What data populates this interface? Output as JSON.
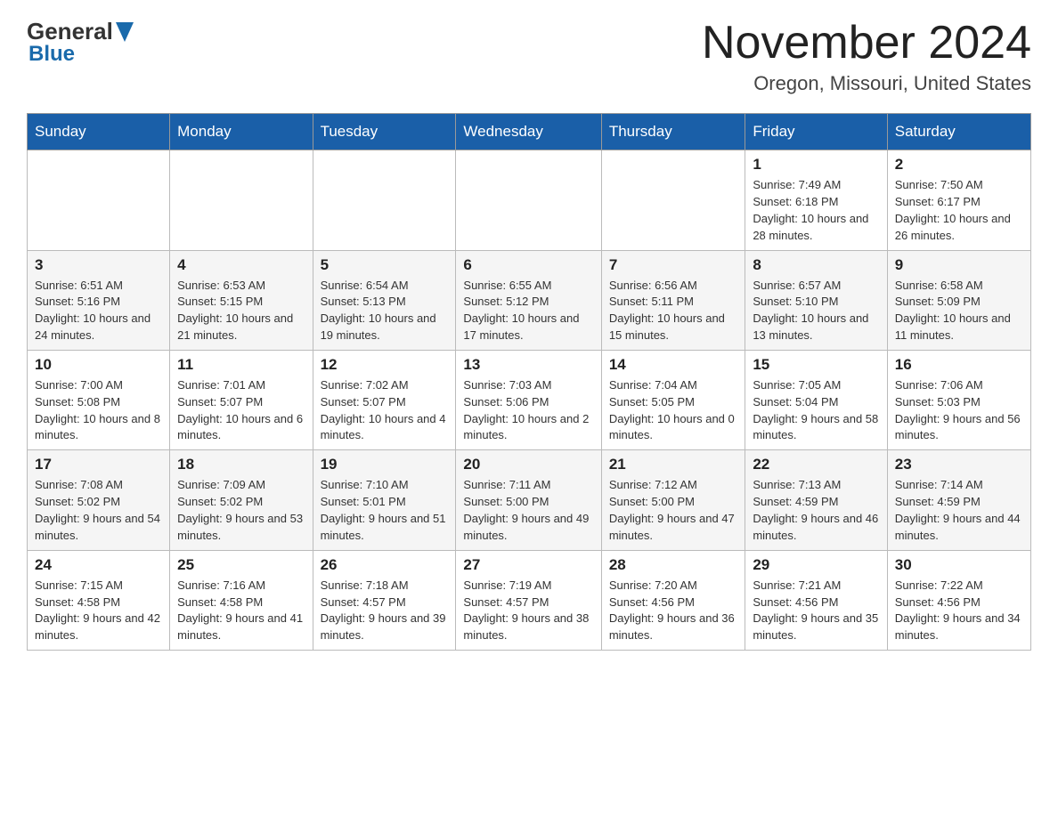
{
  "header": {
    "logo_general": "General",
    "logo_blue": "Blue",
    "month_title": "November 2024",
    "location": "Oregon, Missouri, United States"
  },
  "calendar": {
    "days_of_week": [
      "Sunday",
      "Monday",
      "Tuesday",
      "Wednesday",
      "Thursday",
      "Friday",
      "Saturday"
    ],
    "weeks": [
      {
        "days": [
          {
            "num": "",
            "info": ""
          },
          {
            "num": "",
            "info": ""
          },
          {
            "num": "",
            "info": ""
          },
          {
            "num": "",
            "info": ""
          },
          {
            "num": "",
            "info": ""
          },
          {
            "num": "1",
            "info": "Sunrise: 7:49 AM\nSunset: 6:18 PM\nDaylight: 10 hours and 28 minutes."
          },
          {
            "num": "2",
            "info": "Sunrise: 7:50 AM\nSunset: 6:17 PM\nDaylight: 10 hours and 26 minutes."
          }
        ]
      },
      {
        "days": [
          {
            "num": "3",
            "info": "Sunrise: 6:51 AM\nSunset: 5:16 PM\nDaylight: 10 hours and 24 minutes."
          },
          {
            "num": "4",
            "info": "Sunrise: 6:53 AM\nSunset: 5:15 PM\nDaylight: 10 hours and 21 minutes."
          },
          {
            "num": "5",
            "info": "Sunrise: 6:54 AM\nSunset: 5:13 PM\nDaylight: 10 hours and 19 minutes."
          },
          {
            "num": "6",
            "info": "Sunrise: 6:55 AM\nSunset: 5:12 PM\nDaylight: 10 hours and 17 minutes."
          },
          {
            "num": "7",
            "info": "Sunrise: 6:56 AM\nSunset: 5:11 PM\nDaylight: 10 hours and 15 minutes."
          },
          {
            "num": "8",
            "info": "Sunrise: 6:57 AM\nSunset: 5:10 PM\nDaylight: 10 hours and 13 minutes."
          },
          {
            "num": "9",
            "info": "Sunrise: 6:58 AM\nSunset: 5:09 PM\nDaylight: 10 hours and 11 minutes."
          }
        ]
      },
      {
        "days": [
          {
            "num": "10",
            "info": "Sunrise: 7:00 AM\nSunset: 5:08 PM\nDaylight: 10 hours and 8 minutes."
          },
          {
            "num": "11",
            "info": "Sunrise: 7:01 AM\nSunset: 5:07 PM\nDaylight: 10 hours and 6 minutes."
          },
          {
            "num": "12",
            "info": "Sunrise: 7:02 AM\nSunset: 5:07 PM\nDaylight: 10 hours and 4 minutes."
          },
          {
            "num": "13",
            "info": "Sunrise: 7:03 AM\nSunset: 5:06 PM\nDaylight: 10 hours and 2 minutes."
          },
          {
            "num": "14",
            "info": "Sunrise: 7:04 AM\nSunset: 5:05 PM\nDaylight: 10 hours and 0 minutes."
          },
          {
            "num": "15",
            "info": "Sunrise: 7:05 AM\nSunset: 5:04 PM\nDaylight: 9 hours and 58 minutes."
          },
          {
            "num": "16",
            "info": "Sunrise: 7:06 AM\nSunset: 5:03 PM\nDaylight: 9 hours and 56 minutes."
          }
        ]
      },
      {
        "days": [
          {
            "num": "17",
            "info": "Sunrise: 7:08 AM\nSunset: 5:02 PM\nDaylight: 9 hours and 54 minutes."
          },
          {
            "num": "18",
            "info": "Sunrise: 7:09 AM\nSunset: 5:02 PM\nDaylight: 9 hours and 53 minutes."
          },
          {
            "num": "19",
            "info": "Sunrise: 7:10 AM\nSunset: 5:01 PM\nDaylight: 9 hours and 51 minutes."
          },
          {
            "num": "20",
            "info": "Sunrise: 7:11 AM\nSunset: 5:00 PM\nDaylight: 9 hours and 49 minutes."
          },
          {
            "num": "21",
            "info": "Sunrise: 7:12 AM\nSunset: 5:00 PM\nDaylight: 9 hours and 47 minutes."
          },
          {
            "num": "22",
            "info": "Sunrise: 7:13 AM\nSunset: 4:59 PM\nDaylight: 9 hours and 46 minutes."
          },
          {
            "num": "23",
            "info": "Sunrise: 7:14 AM\nSunset: 4:59 PM\nDaylight: 9 hours and 44 minutes."
          }
        ]
      },
      {
        "days": [
          {
            "num": "24",
            "info": "Sunrise: 7:15 AM\nSunset: 4:58 PM\nDaylight: 9 hours and 42 minutes."
          },
          {
            "num": "25",
            "info": "Sunrise: 7:16 AM\nSunset: 4:58 PM\nDaylight: 9 hours and 41 minutes."
          },
          {
            "num": "26",
            "info": "Sunrise: 7:18 AM\nSunset: 4:57 PM\nDaylight: 9 hours and 39 minutes."
          },
          {
            "num": "27",
            "info": "Sunrise: 7:19 AM\nSunset: 4:57 PM\nDaylight: 9 hours and 38 minutes."
          },
          {
            "num": "28",
            "info": "Sunrise: 7:20 AM\nSunset: 4:56 PM\nDaylight: 9 hours and 36 minutes."
          },
          {
            "num": "29",
            "info": "Sunrise: 7:21 AM\nSunset: 4:56 PM\nDaylight: 9 hours and 35 minutes."
          },
          {
            "num": "30",
            "info": "Sunrise: 7:22 AM\nSunset: 4:56 PM\nDaylight: 9 hours and 34 minutes."
          }
        ]
      }
    ]
  }
}
